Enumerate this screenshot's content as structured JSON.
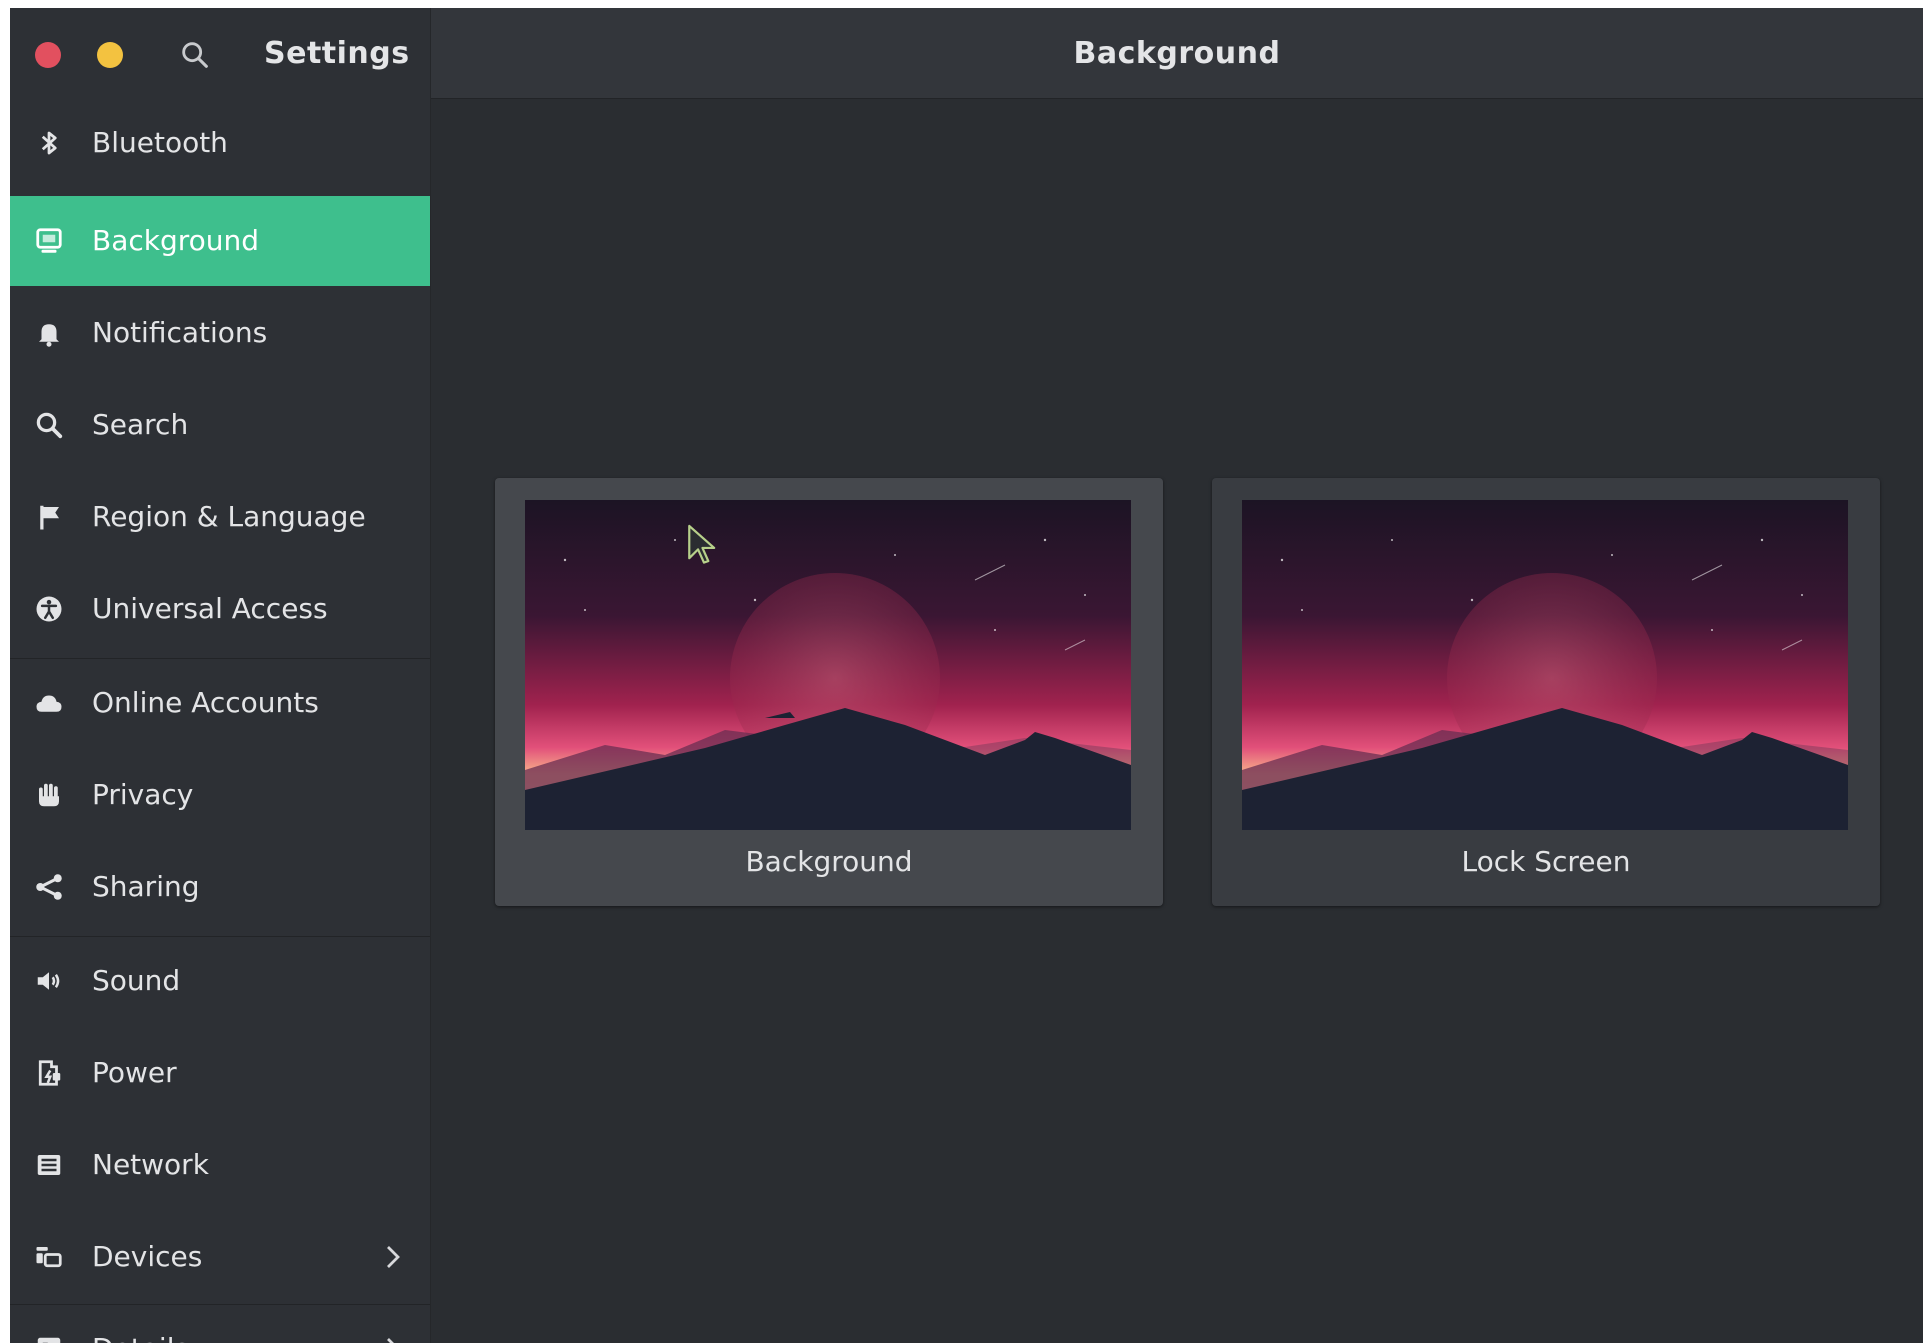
{
  "app": {
    "title": "Settings"
  },
  "panel": {
    "title": "Background"
  },
  "window_controls": [
    {
      "name": "close",
      "color": "#e2505f"
    },
    {
      "name": "minimize",
      "color": "#f3c240"
    }
  ],
  "sidebar": {
    "items": [
      {
        "label": "Bluetooth",
        "icon": "bluetooth-icon"
      },
      {
        "label": "Background",
        "icon": "background-icon",
        "active": true
      },
      {
        "label": "Notifications",
        "icon": "bell-icon"
      },
      {
        "label": "Search",
        "icon": "search-icon"
      },
      {
        "label": "Region & Language",
        "icon": "flag-icon"
      },
      {
        "label": "Universal Access",
        "icon": "accessibility-icon"
      },
      {
        "label": "Online Accounts",
        "icon": "cloud-icon"
      },
      {
        "label": "Privacy",
        "icon": "hand-icon"
      },
      {
        "label": "Sharing",
        "icon": "share-icon"
      },
      {
        "label": "Sound",
        "icon": "speaker-icon"
      },
      {
        "label": "Power",
        "icon": "power-icon"
      },
      {
        "label": "Network",
        "icon": "network-icon"
      },
      {
        "label": "Devices",
        "icon": "devices-icon",
        "submenu": true
      },
      {
        "label": "Details",
        "icon": "details-icon",
        "submenu": true
      }
    ]
  },
  "cards": [
    {
      "label": "Background"
    },
    {
      "label": "Lock Screen"
    }
  ],
  "colors": {
    "accent": "#3ebf8d",
    "sidebar_bg": "#2d3035",
    "content_bg": "#2a2d31",
    "header_bg": "#33363b"
  }
}
